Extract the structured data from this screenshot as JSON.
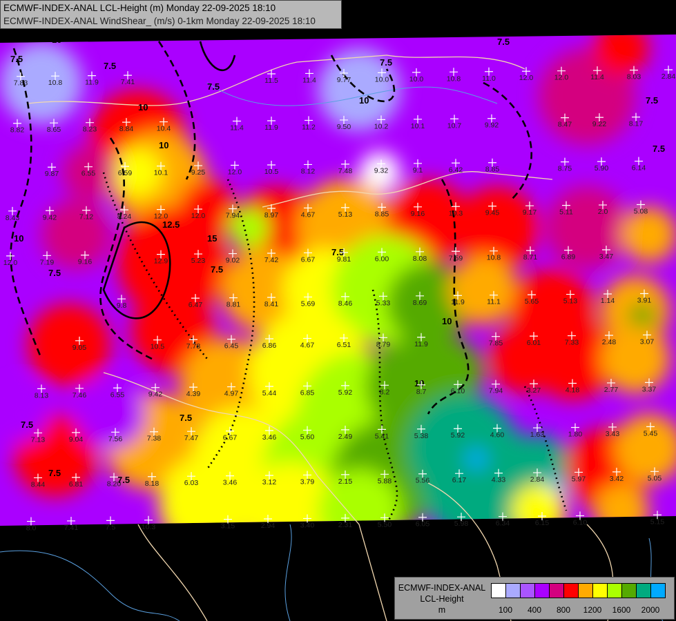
{
  "header": {
    "line1": "ECMWF-INDEX-ANAL LCL-Height (m) Monday 22-09-2025 18:10",
    "line2": "ECMWF-INDEX-ANAL WindShear_ (m/s) 0-1km Monday 22-09-2025 18:10"
  },
  "legend": {
    "model": "ECMWF-INDEX-ANAL",
    "parameter": "LCL-Height",
    "unit": "m",
    "colors": [
      "#ffffff",
      "#aaaaff",
      "#aa55ff",
      "#aa00ff",
      "#d4007f",
      "#ff0000",
      "#ffaa00",
      "#ffff00",
      "#aaff00",
      "#55aa00",
      "#00aa7f",
      "#00aaff"
    ],
    "ticks": [
      "100",
      "400",
      "800",
      "1200",
      "1600",
      "2000"
    ]
  },
  "shear_contour_labels": [
    "7.5",
    "10",
    "12.5",
    "15"
  ],
  "station_rows": [
    [
      "7.83",
      "10.8",
      "11.9",
      "7.41",
      "11.5",
      "11.4",
      "9.77",
      "10.0",
      "10.0",
      "10.8",
      "11.0",
      "12.0",
      "12.0",
      "11.4",
      "8.03",
      "2.84"
    ],
    [
      "8.82",
      "8.65",
      "8.23",
      "8.84",
      "10.4",
      "11.4",
      "11.9",
      "11.2",
      "9.50",
      "10.2",
      "10.1",
      "10.7",
      "9.92",
      "8.47",
      "9.22",
      "8.17"
    ],
    [
      "9.87",
      "6.55",
      "6.59",
      "10.1",
      "9.25",
      "12.0",
      "10.5",
      "8.12",
      "7.48",
      "9.32",
      "9.1",
      "6.42",
      "8.85",
      "8.75",
      "5.90",
      "6.14"
    ],
    [
      "8.43",
      "9.42",
      "7.12",
      "8.24",
      "12.0",
      "12.0",
      "7.94",
      "8.97",
      "4.67",
      "5.13",
      "8.85",
      "9.16",
      "10.3",
      "9.45",
      "9.17",
      "5.11",
      "2.0",
      "5.08"
    ],
    [
      "12.0",
      "7.19",
      "9.16",
      "12.9",
      "5.23",
      "9.02",
      "7.42",
      "6.67",
      "9.81",
      "6.00",
      "8.08",
      "7.59",
      "10.8",
      "8.71",
      "6.89",
      "3.47"
    ],
    [
      "9.8",
      "6.47",
      "8.81",
      "8.41",
      "5.69",
      "8.46",
      "5.33",
      "8.69",
      "11.9",
      "11.1",
      "5.65",
      "5.13",
      "1.14",
      "3.91"
    ],
    [
      "9.05",
      "10.5",
      "7.78",
      "6.45",
      "6.86",
      "4.67",
      "6.51",
      "8.79",
      "11.9",
      "7.85",
      "6.01",
      "7.33",
      "2.48",
      "3.07"
    ],
    [
      "8.13",
      "7.46",
      "6.55",
      "9.42",
      "4.39",
      "4.97",
      "5.44",
      "6.85",
      "5.92",
      "8.2",
      "8.7",
      "6.10",
      "7.94",
      "3.27",
      "4.18",
      "2.77",
      "3.37"
    ],
    [
      "7.13",
      "9.04",
      "7.56",
      "7.38",
      "7.47",
      "6.67",
      "3.46",
      "5.60",
      "2.49",
      "5.41",
      "5.38",
      "5.92",
      "4.60",
      "1.63",
      "1.80",
      "3.43",
      "5.45"
    ],
    [
      "8.44",
      "6.81",
      "8.20",
      "8.18",
      "6.03",
      "3.46",
      "3.12",
      "3.79",
      "2.15",
      "5.88",
      "5.56",
      "6.17",
      "4.33",
      "2.84",
      "5.97",
      "3.42",
      "5.05"
    ],
    [
      "8.0",
      "7.41",
      "7.5",
      "10.3",
      "3.15",
      "2.94",
      "3.40",
      "2.31",
      "5.50",
      "6.05",
      "5.98",
      "6.34",
      "6.15",
      "6.10",
      "5.15"
    ]
  ]
}
